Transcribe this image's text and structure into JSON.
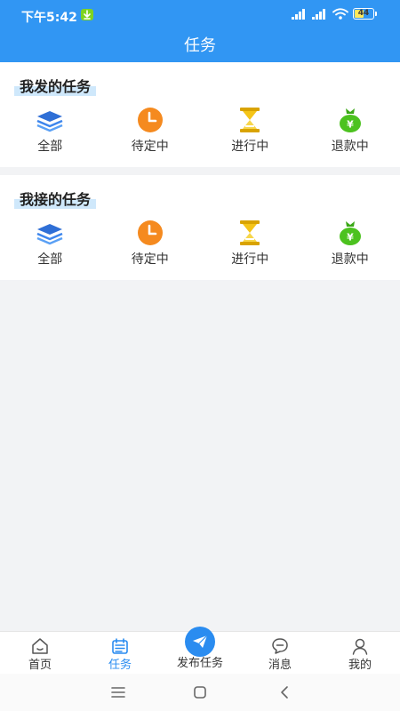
{
  "status_bar": {
    "time": "下午5:42",
    "battery": "44"
  },
  "nav": {
    "title": "任务"
  },
  "sections": [
    {
      "title": "我发的任务",
      "items": [
        {
          "label": "全部",
          "icon": "layers-icon"
        },
        {
          "label": "待定中",
          "icon": "clock-icon"
        },
        {
          "label": "进行中",
          "icon": "hourglass-icon"
        },
        {
          "label": "退款中",
          "icon": "money-bag-icon"
        }
      ]
    },
    {
      "title": "我接的任务",
      "items": [
        {
          "label": "全部",
          "icon": "layers-icon"
        },
        {
          "label": "待定中",
          "icon": "clock-icon"
        },
        {
          "label": "进行中",
          "icon": "hourglass-icon"
        },
        {
          "label": "退款中",
          "icon": "money-bag-icon"
        }
      ]
    }
  ],
  "tabbar": {
    "items": [
      {
        "label": "首页",
        "icon": "home-icon"
      },
      {
        "label": "任务",
        "icon": "calendar-icon",
        "active": true
      },
      {
        "label": "发布任务",
        "icon": "paper-plane-icon"
      },
      {
        "label": "消息",
        "icon": "chat-bubble-icon"
      },
      {
        "label": "我的",
        "icon": "user-icon"
      }
    ]
  },
  "colors": {
    "primary": "#3196f3",
    "active_tab": "#2a8cf0",
    "title_highlight": "#cfe8fb",
    "clock_orange": "#f58a1f",
    "hourglass_yellow": "#f5c518",
    "money_green": "#4cc21f",
    "layers_blue": "#3a7be0"
  }
}
